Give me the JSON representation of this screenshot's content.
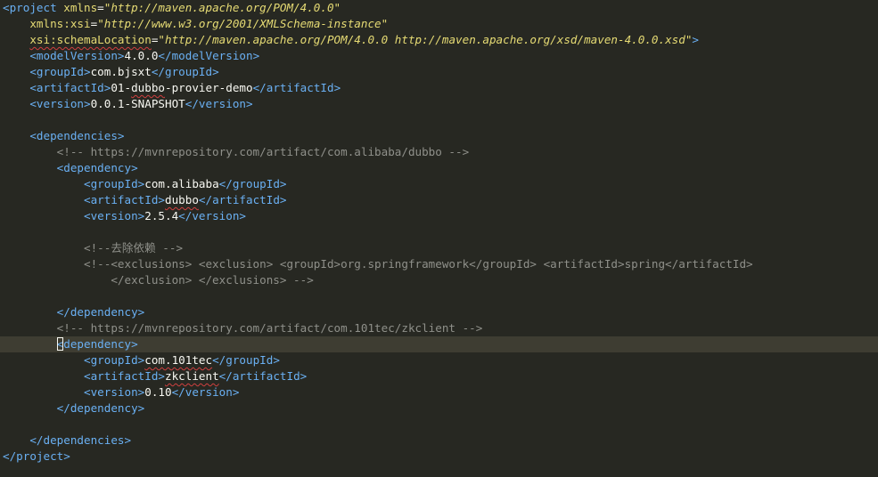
{
  "editor": {
    "language": "xml",
    "current_line_index": 21,
    "lines": [
      {
        "indent": "",
        "tokens": [
          [
            "tag",
            "<project "
          ],
          [
            "attrnm",
            "xmlns"
          ],
          [
            "punct",
            "="
          ],
          [
            "str",
            "\"http://maven.apache.org/POM/4.0.0\""
          ]
        ]
      },
      {
        "indent": "    ",
        "tokens": [
          [
            "attrnm",
            "xmlns:xsi"
          ],
          [
            "punct",
            "="
          ],
          [
            "str",
            "\"http://www.w3.org/2001/XMLSchema-instance\""
          ]
        ]
      },
      {
        "indent": "    ",
        "tokens": [
          [
            "attrnm",
            "xsi:schemaLocation"
          ],
          [
            "punct",
            "="
          ],
          [
            "str",
            "\"http://maven.apache.org/POM/4.0.0 http://maven.apache.org/xsd/maven-4.0.0.xsd\""
          ],
          [
            "tag",
            ">"
          ]
        ],
        "squiggle": true
      },
      {
        "indent": "    ",
        "tokens": [
          [
            "tag",
            "<modelVersion>"
          ],
          [
            "text",
            "4.0.0"
          ],
          [
            "tag",
            "</modelVersion>"
          ]
        ]
      },
      {
        "indent": "    ",
        "tokens": [
          [
            "tag",
            "<groupId>"
          ],
          [
            "text",
            "com.bjsxt"
          ],
          [
            "tag",
            "</groupId>"
          ]
        ]
      },
      {
        "indent": "    ",
        "tokens": [
          [
            "tag",
            "<artifactId>"
          ],
          [
            "text",
            "01-dubbo-provier-demo"
          ],
          [
            "tag",
            "</artifactId>"
          ]
        ]
      },
      {
        "indent": "    ",
        "tokens": [
          [
            "tag",
            "<version>"
          ],
          [
            "text",
            "0.0.1-SNAPSHOT"
          ],
          [
            "tag",
            "</version>"
          ]
        ]
      },
      {
        "indent": "",
        "tokens": []
      },
      {
        "indent": "    ",
        "tokens": [
          [
            "tag",
            "<dependencies>"
          ]
        ]
      },
      {
        "indent": "        ",
        "tokens": [
          [
            "comment",
            "<!-- https://mvnrepository.com/artifact/com.alibaba/dubbo -->"
          ]
        ]
      },
      {
        "indent": "        ",
        "tokens": [
          [
            "tag",
            "<dependency>"
          ]
        ]
      },
      {
        "indent": "            ",
        "tokens": [
          [
            "tag",
            "<groupId>"
          ],
          [
            "text",
            "com.alibaba"
          ],
          [
            "tag",
            "</groupId>"
          ]
        ]
      },
      {
        "indent": "            ",
        "tokens": [
          [
            "tag",
            "<artifactId>"
          ],
          [
            "text",
            "dubbo"
          ],
          [
            "tag",
            "</artifactId>"
          ]
        ]
      },
      {
        "indent": "            ",
        "tokens": [
          [
            "tag",
            "<version>"
          ],
          [
            "text",
            "2.5.4"
          ],
          [
            "tag",
            "</version>"
          ]
        ]
      },
      {
        "indent": "",
        "tokens": []
      },
      {
        "indent": "            ",
        "tokens": [
          [
            "comment",
            "<!--去除依赖 -->"
          ]
        ]
      },
      {
        "indent": "            ",
        "tokens": [
          [
            "comment",
            "<!--<exclusions> <exclusion> <groupId>org.springframework</groupId> <artifactId>spring</artifactId>"
          ]
        ]
      },
      {
        "indent": "                ",
        "tokens": [
          [
            "comment",
            "</exclusion> </exclusions> -->"
          ]
        ]
      },
      {
        "indent": "",
        "tokens": []
      },
      {
        "indent": "        ",
        "tokens": [
          [
            "tag",
            "</dependency>"
          ]
        ]
      },
      {
        "indent": "        ",
        "tokens": [
          [
            "comment",
            "<!-- https://mvnrepository.com/artifact/com.101tec/zkclient -->"
          ]
        ]
      },
      {
        "indent": "        ",
        "tokens": [
          [
            "tag",
            "<dependency>"
          ]
        ]
      },
      {
        "indent": "            ",
        "tokens": [
          [
            "tag",
            "<groupId>"
          ],
          [
            "text",
            "com.101tec"
          ],
          [
            "tag",
            "</groupId>"
          ]
        ]
      },
      {
        "indent": "            ",
        "tokens": [
          [
            "tag",
            "<artifactId>"
          ],
          [
            "text",
            "zkclient"
          ],
          [
            "tag",
            "</artifactId>"
          ]
        ]
      },
      {
        "indent": "            ",
        "tokens": [
          [
            "tag",
            "<version>"
          ],
          [
            "text",
            "0.10"
          ],
          [
            "tag",
            "</version>"
          ]
        ]
      },
      {
        "indent": "        ",
        "tokens": [
          [
            "tag",
            "</dependency>"
          ]
        ]
      },
      {
        "indent": "",
        "tokens": []
      },
      {
        "indent": "    ",
        "tokens": [
          [
            "tag",
            "</dependencies>"
          ]
        ]
      },
      {
        "indent": "",
        "tokens": [
          [
            "tag",
            "</project>"
          ]
        ]
      }
    ],
    "squiggle_words": [
      "dubbo",
      "provier",
      "zkclient",
      "com.101tec"
    ]
  },
  "colors": {
    "background": "#272822",
    "current_line": "#3e3d32",
    "tag": "#6ab0f3",
    "attribute_name": "#e6db74",
    "string": "#e6db74",
    "text": "#f8f8f2",
    "comment": "#8f908a"
  }
}
